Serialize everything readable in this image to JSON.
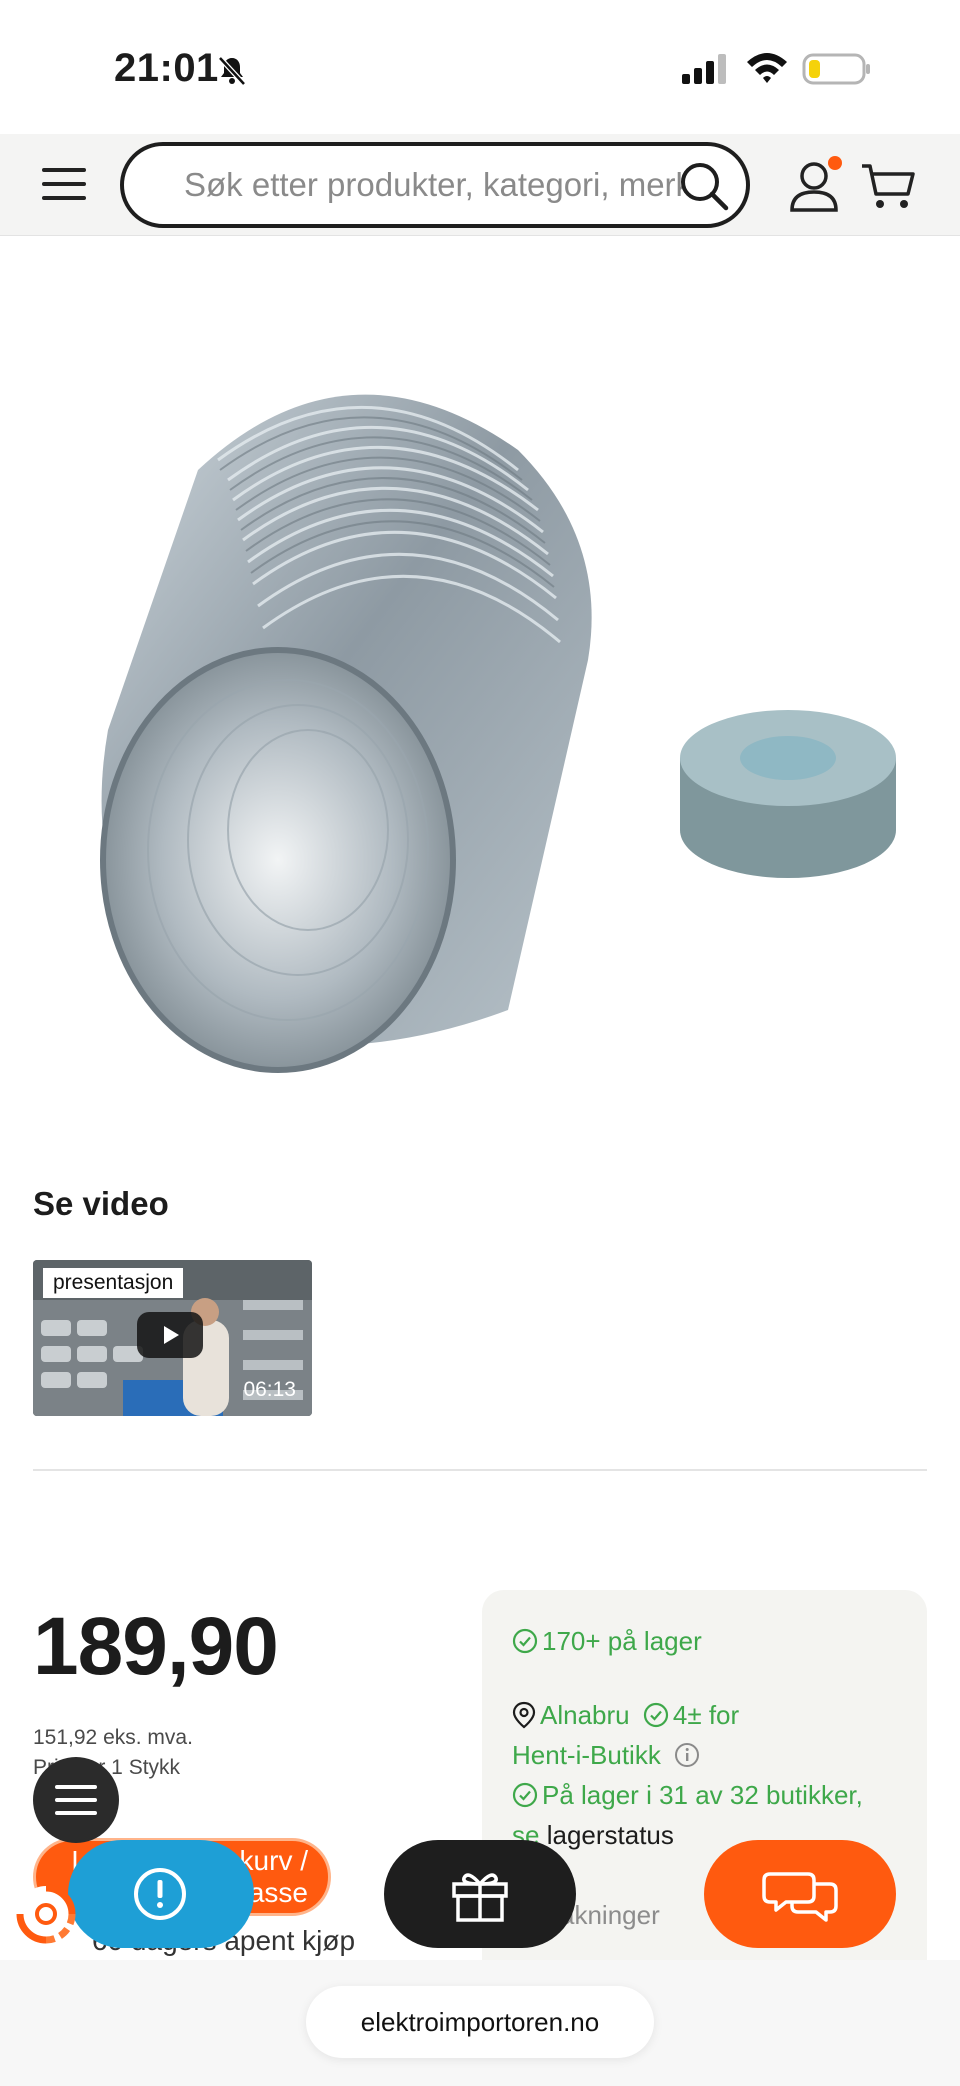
{
  "status_bar": {
    "time": "21:01",
    "icons": [
      "bell-slash-icon",
      "cellular-signal-icon",
      "wifi-icon",
      "battery-low-icon"
    ]
  },
  "header": {
    "search_placeholder": "Søk etter produkter, kategori, merke",
    "icons": [
      "hamburger-menu-icon",
      "search-icon",
      "account-icon",
      "cart-icon"
    ],
    "notification_color": "#ff5a0f"
  },
  "product": {
    "image": "flexible-aluminium-duct-with-grey-bushing"
  },
  "video": {
    "heading": "Se video",
    "label": "presentasjon",
    "duration": "06:13"
  },
  "pricing": {
    "price": "189,90",
    "ex_vat": "151,92 eks. mva.",
    "unit": "Pris per 1 Stykk",
    "add_to_cart_label": "Legg i handlekurv / kasse",
    "return_policy": "60 dagers åpent kjøp"
  },
  "stock": {
    "online": "170+ på lager",
    "store_name": "Alnabru",
    "store_stock": "4± for",
    "store_pickup": "Hent-i-Butikk",
    "stores_summary": "På lager i 31 av 32 butikker,",
    "see_link": "se",
    "stock_status": "lagerstatus",
    "shipping": "akninger"
  },
  "floating": {
    "icons": [
      "menu-lines-icon",
      "exclamation-icon",
      "gift-icon",
      "chat-bubbles-icon",
      "brand-logo-icon"
    ]
  },
  "browser": {
    "url": "elektroimportoren.no"
  },
  "colors": {
    "accent_orange": "#ff5a0f",
    "stock_green": "#3ea84a",
    "info_blue": "#1e9fd6",
    "dark": "#1e1e1e"
  }
}
